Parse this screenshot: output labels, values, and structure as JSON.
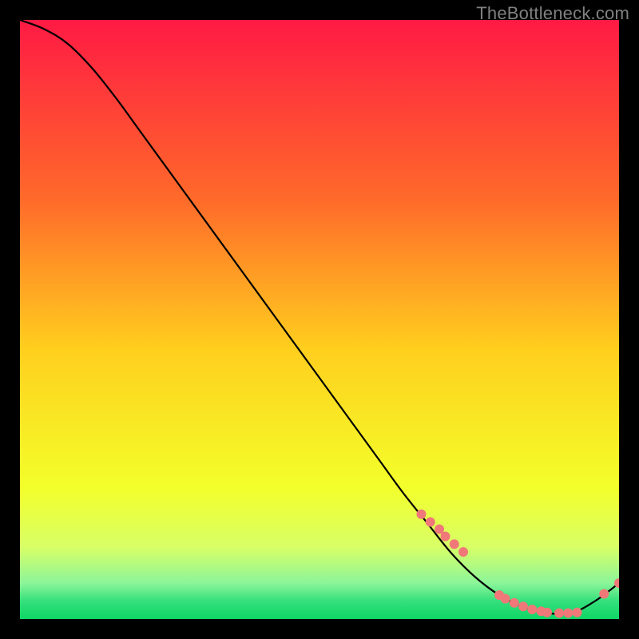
{
  "watermark": "TheBottleneck.com",
  "chart_data": {
    "type": "line",
    "title": "",
    "xlabel": "",
    "ylabel": "",
    "xlim": [
      0,
      100
    ],
    "ylim": [
      0,
      100
    ],
    "grid": false,
    "legend": false,
    "gradient_stops": [
      {
        "offset": 0.0,
        "color": "#ff1a44"
      },
      {
        "offset": 0.3,
        "color": "#ff6a2a"
      },
      {
        "offset": 0.55,
        "color": "#ffcf1e"
      },
      {
        "offset": 0.78,
        "color": "#f3ff2a"
      },
      {
        "offset": 0.88,
        "color": "#d8ff67"
      },
      {
        "offset": 0.94,
        "color": "#8cf59a"
      },
      {
        "offset": 0.97,
        "color": "#35e07c"
      },
      {
        "offset": 1.0,
        "color": "#0fd665"
      }
    ],
    "series": [
      {
        "name": "bottleneck-curve",
        "type": "line",
        "color": "#000000",
        "x": [
          0,
          4,
          8,
          12,
          16,
          20,
          24,
          28,
          32,
          36,
          40,
          44,
          48,
          52,
          56,
          60,
          64,
          68,
          72,
          76,
          80,
          84,
          88,
          92,
          96,
          100
        ],
        "y": [
          100,
          98.5,
          96,
          92,
          87,
          81.5,
          76,
          70.5,
          65,
          59.5,
          54,
          48.5,
          43,
          37.5,
          32,
          26.5,
          21,
          16,
          11,
          7,
          4,
          2,
          1,
          1,
          3,
          6
        ]
      },
      {
        "name": "highlight-points",
        "type": "scatter",
        "color": "#f07878",
        "radius": 6,
        "x": [
          67,
          68.5,
          70,
          71,
          72.5,
          74,
          80,
          81,
          82.5,
          84,
          85.5,
          87,
          88,
          90,
          91.5,
          93,
          97.5,
          100
        ],
        "y": [
          17.5,
          16.2,
          15,
          13.8,
          12.5,
          11.2,
          4,
          3.4,
          2.7,
          2.1,
          1.6,
          1.3,
          1.1,
          1,
          1,
          1.1,
          4.2,
          6
        ]
      }
    ]
  }
}
